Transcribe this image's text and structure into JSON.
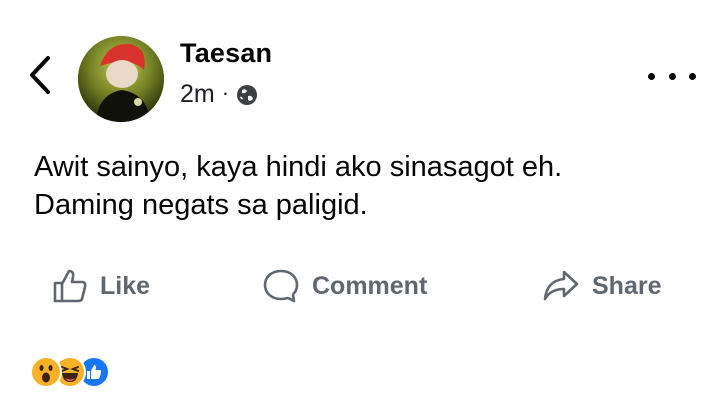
{
  "post": {
    "author": "Taesan",
    "timestamp": "2m",
    "separator": "·",
    "audience_icon": "globe-icon",
    "text_line1": "Awit sainyo, kaya hindi ako sinasagot eh.",
    "text_line2": "Daming negats sa paligid."
  },
  "actions": {
    "like_label": "Like",
    "comment_label": "Comment",
    "share_label": "Share"
  },
  "reactions": [
    "wow",
    "haha",
    "like"
  ],
  "colors": {
    "action_gray": "#606770",
    "reaction_yellow": "#f7b125",
    "like_blue": "#1877f2"
  }
}
